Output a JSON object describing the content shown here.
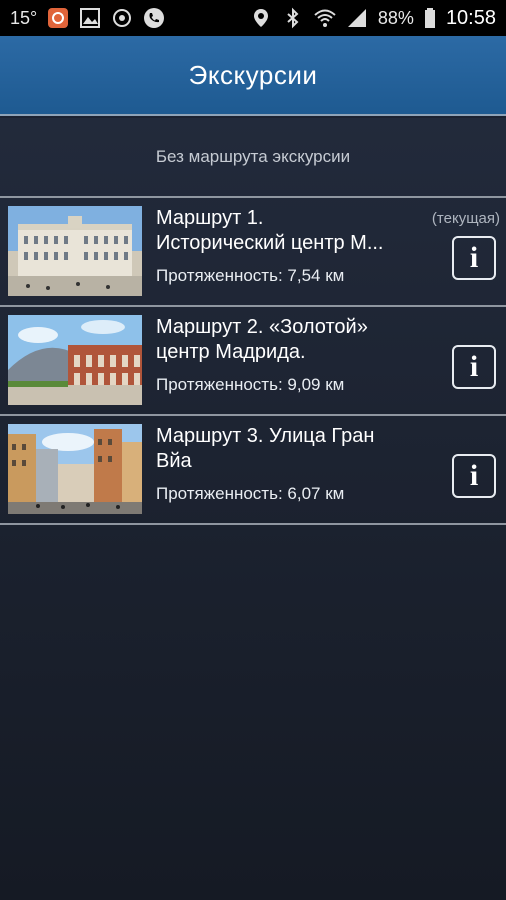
{
  "status_bar": {
    "temperature": "15°",
    "battery": "88%",
    "time": "10:58",
    "icons": [
      "app-notification-icon",
      "image-icon",
      "sync-icon",
      "phone-icon",
      "location-icon",
      "bluetooth-icon",
      "wifi-icon",
      "signal-icon",
      "battery-icon"
    ]
  },
  "header": {
    "title": "Экскурсии"
  },
  "no_route": {
    "label": "Без маршрута экскурсии"
  },
  "routes": [
    {
      "title_line1": "Маршрут 1.",
      "title_line2": "Исторический центр М...",
      "length": "Протяженность: 7,54 км",
      "current_label": "(текущая)"
    },
    {
      "title_line1": "Маршрут 2. «Золотой»",
      "title_line2": "центр Мадрида.",
      "length": "Протяженность: 9,09 км"
    },
    {
      "title_line1": "Маршрут 3. Улица Гран",
      "title_line2": "Вйа",
      "length": "Протяженность: 6,07 км"
    }
  ],
  "info_icon_glyph": "i",
  "colors": {
    "app_bar": "#2464a0",
    "background": "#1c2231",
    "divider": "#8f96a0",
    "accent_notification": "#e0643a"
  }
}
